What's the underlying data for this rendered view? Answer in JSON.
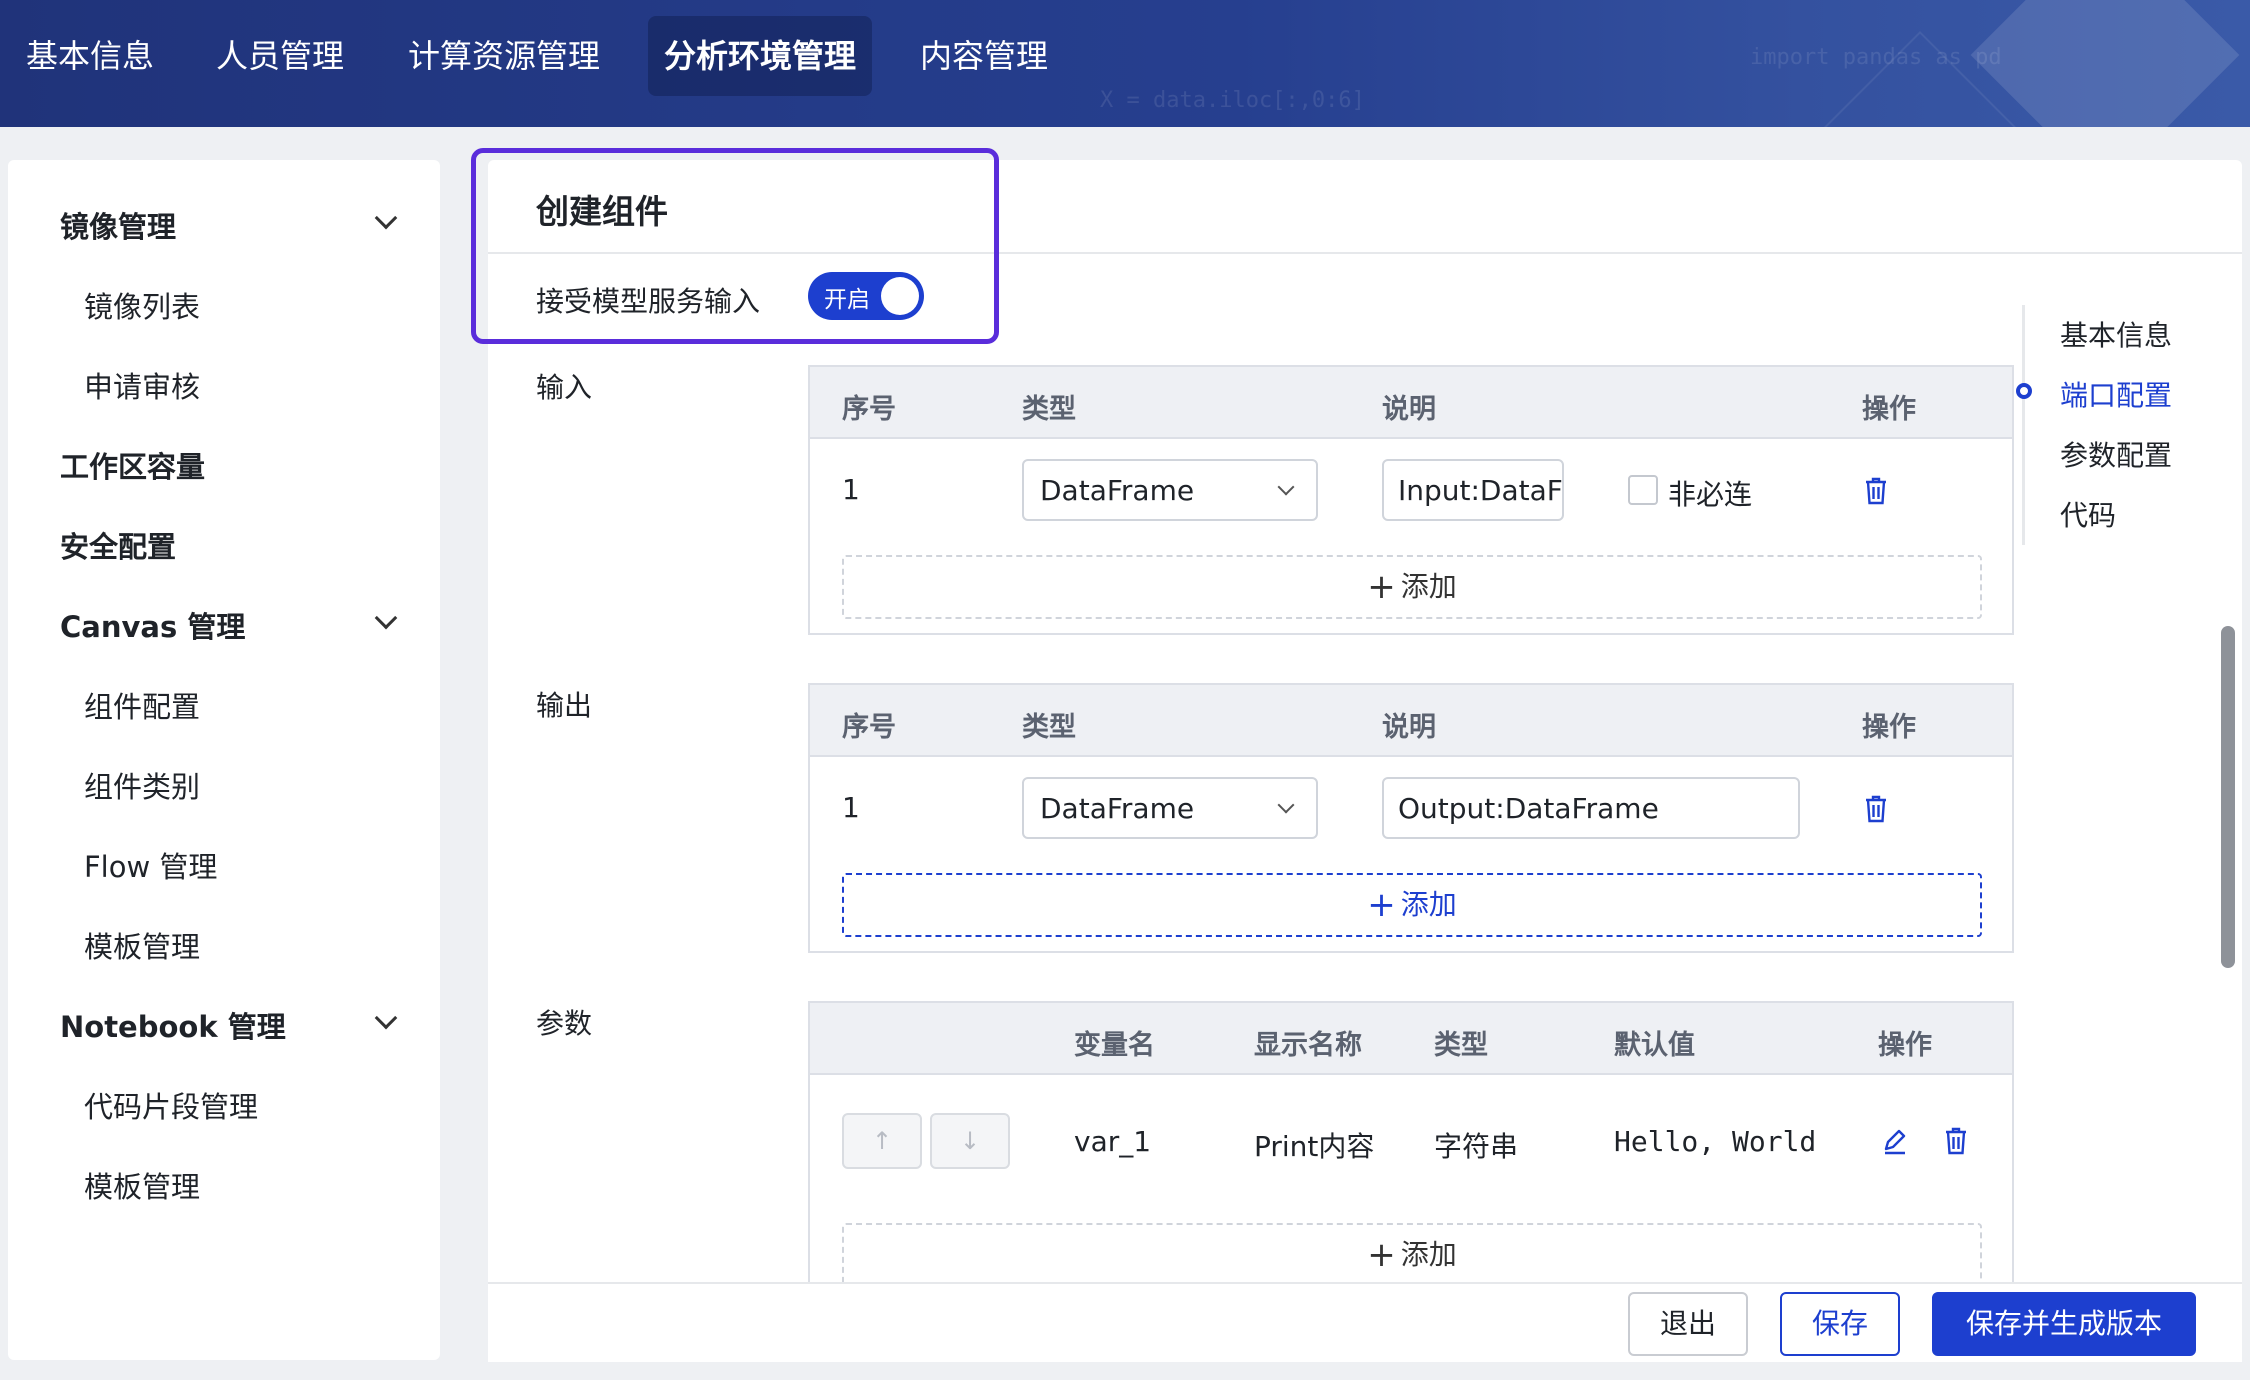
{
  "topnav": {
    "items": [
      "基本信息",
      "人员管理",
      "计算资源管理",
      "分析环境管理",
      "内容管理"
    ],
    "active": "分析环境管理",
    "bg_code_1": "import pandas as pd",
    "bg_code_2": "X = data.iloc[:,0:6]"
  },
  "sidebar": {
    "groups": [
      {
        "label": "镜像管理",
        "expanded": true,
        "children": [
          "镜像列表",
          "申请审核"
        ]
      },
      {
        "label": "工作区容量"
      },
      {
        "label": "安全配置"
      },
      {
        "label": "Canvas 管理",
        "expanded": true,
        "children": [
          "组件配置",
          "组件类别",
          "Flow 管理",
          "模板管理"
        ]
      },
      {
        "label": "Notebook 管理",
        "expanded": true,
        "children": [
          "代码片段管理",
          "模板管理"
        ]
      }
    ]
  },
  "form": {
    "title": "创建组件",
    "accept_model_input_label": "接受模型服务输入",
    "toggle_label": "开启",
    "toggle_on": true,
    "input_label": "输入",
    "output_label": "输出",
    "params_label": "参数",
    "add_label": "添加",
    "port_headers": [
      "序号",
      "类型",
      "说明",
      "操作"
    ],
    "input_rows": [
      {
        "index": "1",
        "type": "DataFrame",
        "desc": "Input:DataFrame",
        "optional_label": "非必连",
        "optional_checked": false
      }
    ],
    "output_rows": [
      {
        "index": "1",
        "type": "DataFrame",
        "desc": "Output:DataFrame"
      }
    ],
    "param_headers": [
      "变量名",
      "显示名称",
      "类型",
      "默认值",
      "操作"
    ],
    "param_rows": [
      {
        "var": "var_1",
        "display": "Print内容",
        "type": "字符串",
        "default": "Hello, World"
      }
    ]
  },
  "anchors": {
    "items": [
      "基本信息",
      "端口配置",
      "参数配置",
      "代码"
    ],
    "active": "端口配置"
  },
  "footer": {
    "exit": "退出",
    "save": "保存",
    "save_version": "保存并生成版本"
  },
  "colors": {
    "primary": "#1d3fcf",
    "highlight_border": "#5a2ddb",
    "nav_bg": "#263f8f"
  }
}
